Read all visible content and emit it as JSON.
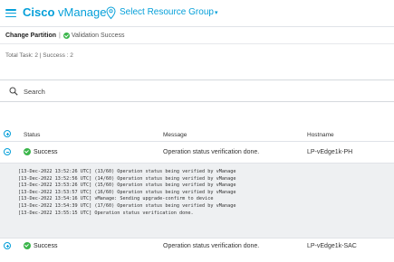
{
  "header": {
    "brand_bold": "Cisco",
    "brand_rest": " vManage",
    "resource_group": "Select Resource Group",
    "caret": "▾"
  },
  "subheader": {
    "title": "Change Partition",
    "separator": "|",
    "status": "Validation Success"
  },
  "summary": {
    "totals": "Total Task: 2 | Success : 2"
  },
  "search": {
    "label": "Search"
  },
  "table": {
    "headers": {
      "status": "Status",
      "message": "Message",
      "hostname": "Hostname"
    },
    "rows": [
      {
        "status": "Success",
        "message": "Operation status verification done.",
        "hostname": "LP-vEdge1k-PH",
        "expanded": true,
        "log": [
          "[13-Dec-2022 13:52:26 UTC] (13/60) Operation status being verified by vManage",
          "[13-Dec-2022 13:52:56 UTC] (14/60) Operation status being verified by vManage",
          "[13-Dec-2022 13:53:26 UTC] (15/60) Operation status being verified by vManage",
          "[13-Dec-2022 13:53:57 UTC] (16/60) Operation status being verified by vManage",
          "[13-Dec-2022 13:54:16 UTC] vManage: Sending upgrade-confirm to device",
          "[13-Dec-2022 13:54:39 UTC] (17/60) Operation status being verified by vManage",
          "[13-Dec-2022 13:55:15 UTC] Operation status verification done."
        ]
      },
      {
        "status": "Success",
        "message": "Operation status verification done.",
        "hostname": "LP-vEdge1k-SAC",
        "expanded": false
      }
    ]
  },
  "colors": {
    "accent": "#049fd9",
    "success": "#3ab54a"
  },
  "icons": [
    "hamburger-menu-icon",
    "location-pin-icon",
    "check-circle-icon",
    "search-icon",
    "expand-icon",
    "collapse-icon"
  ]
}
